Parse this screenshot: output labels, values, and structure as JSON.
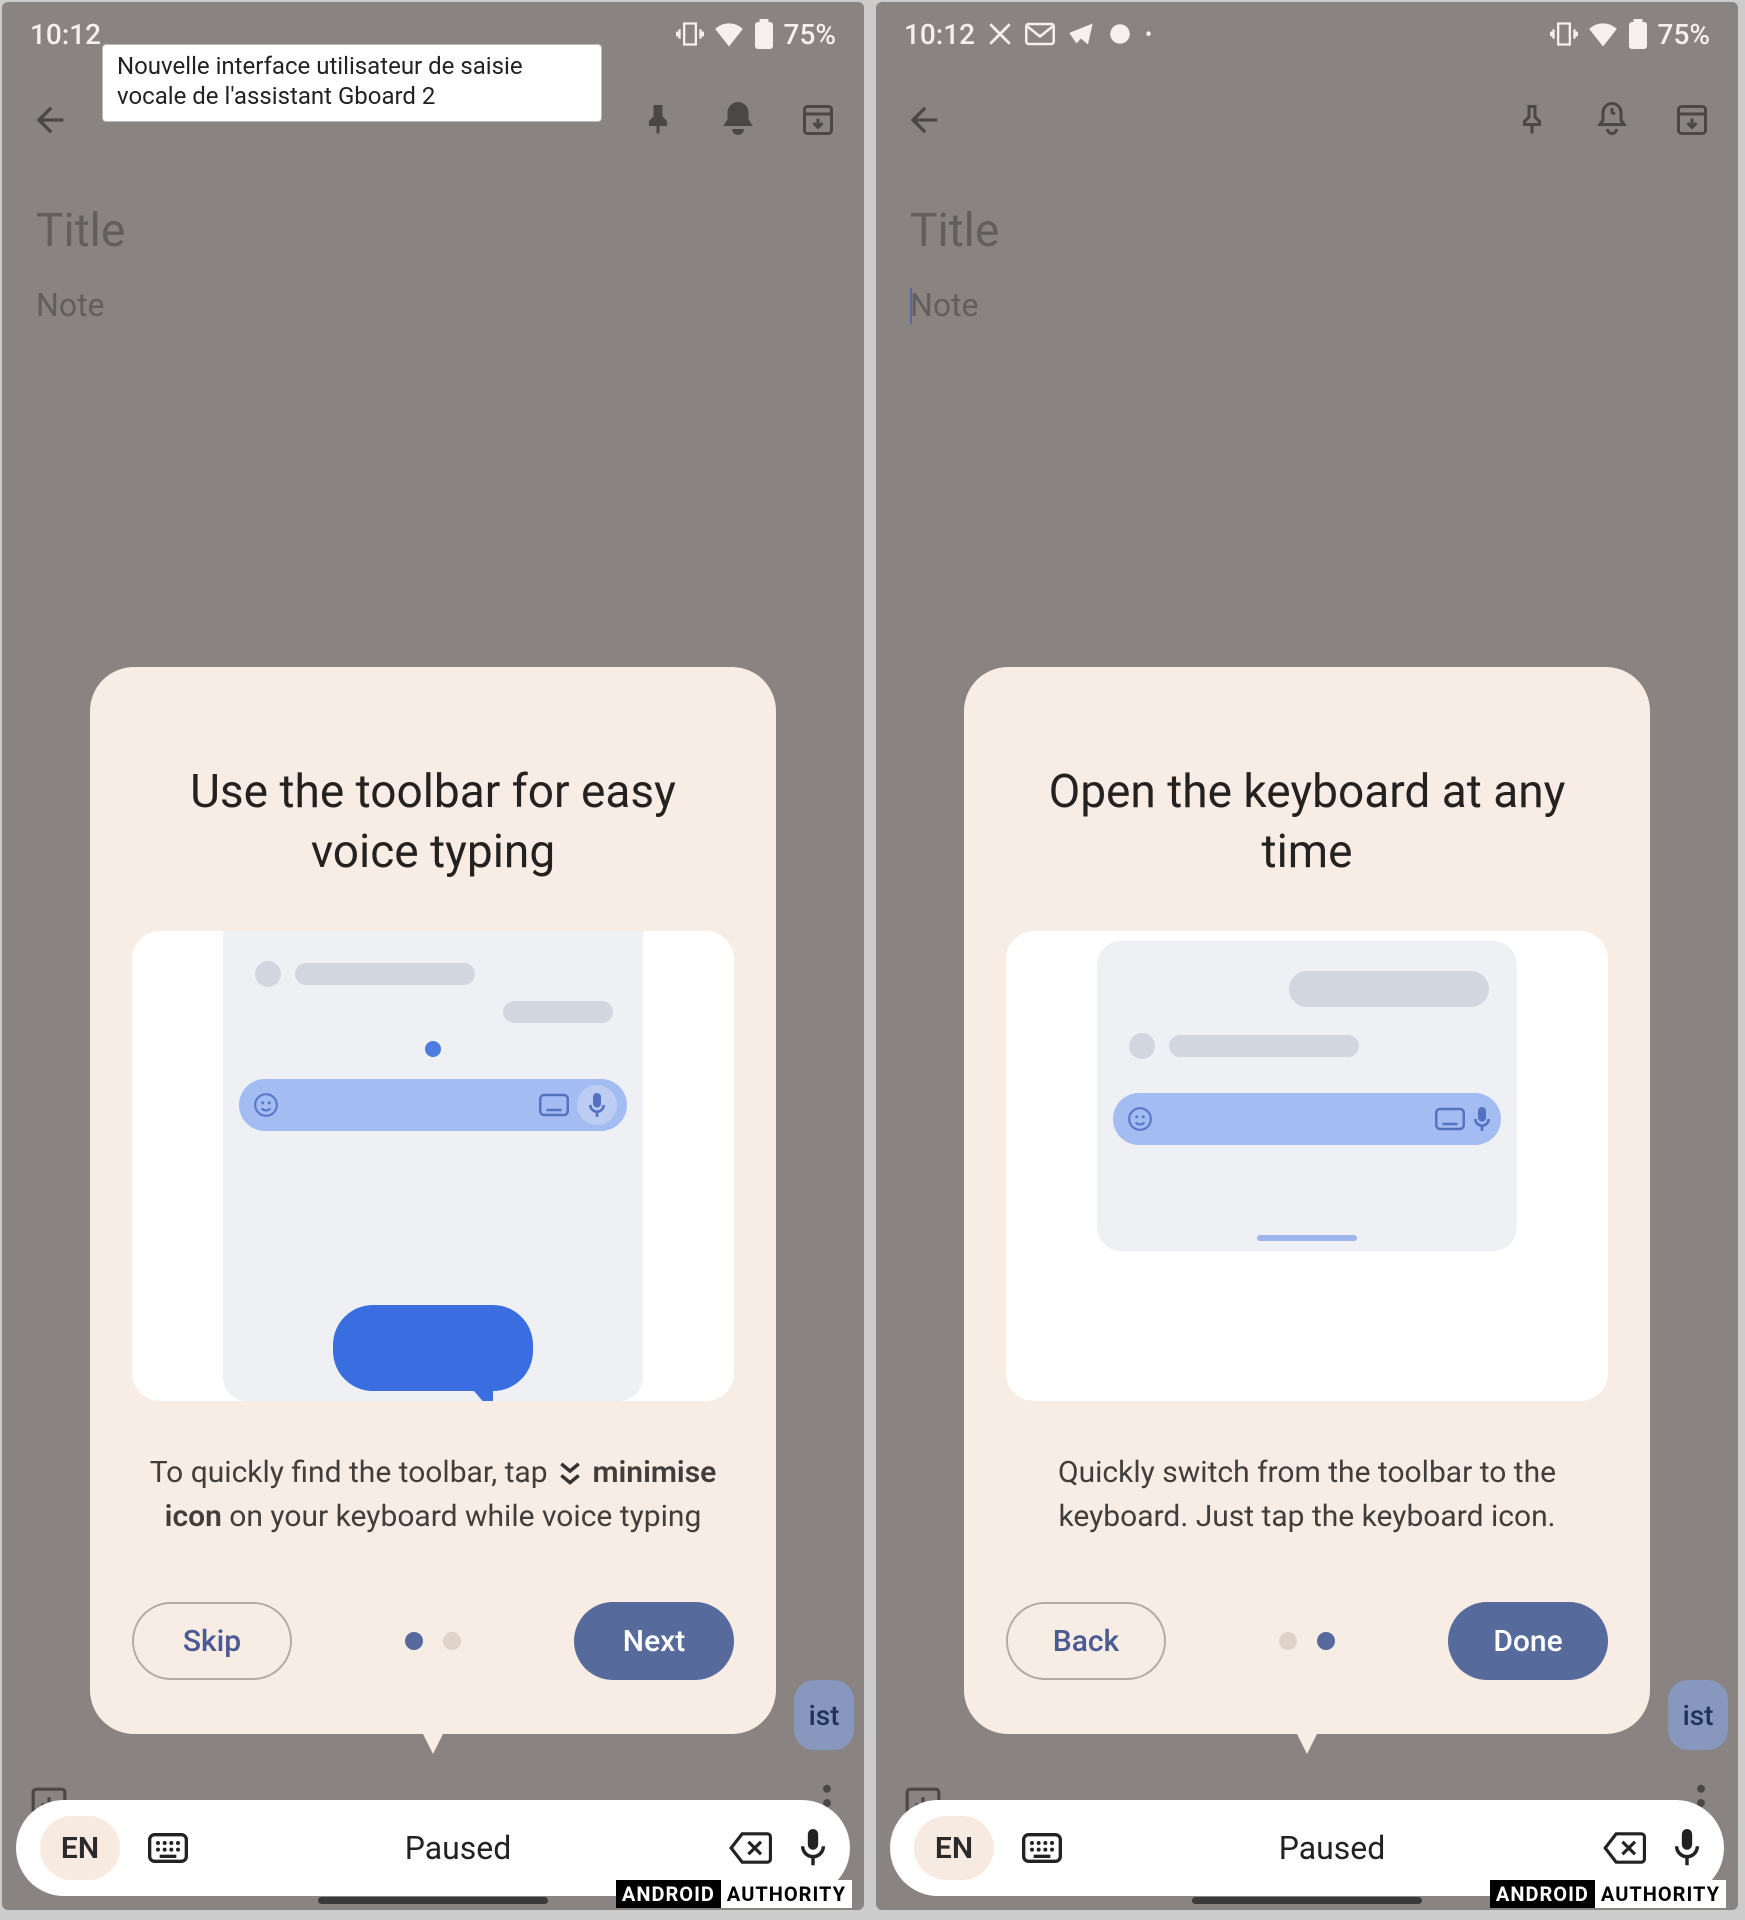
{
  "status": {
    "time_left": "10:12",
    "time_right": "10:12",
    "battery": "75%"
  },
  "tooltip": "Nouvelle interface utilisateur de saisie vocale de l'assistant Gboard 2",
  "note_app": {
    "title_placeholder": "Title",
    "body_placeholder": "Note"
  },
  "voicebar": {
    "lang": "EN",
    "status": "Paused"
  },
  "peek_chip": "ist",
  "watermark": {
    "a": "ANDROID",
    "b": "AUTHORITY"
  },
  "card_left": {
    "heading": "Use the toolbar for easy voice typing",
    "caption_pre": "To quickly find the toolbar, tap ",
    "caption_bold": "minimise icon",
    "caption_post": " on your keyboard while voice typing",
    "btn_secondary": "Skip",
    "btn_primary": "Next",
    "active_dot": 0
  },
  "card_right": {
    "heading": "Open the keyboard at any time",
    "caption": "Quickly switch from the toolbar to the keyboard. Just tap the keyboard icon.",
    "btn_secondary": "Back",
    "btn_primary": "Done",
    "active_dot": 1
  }
}
